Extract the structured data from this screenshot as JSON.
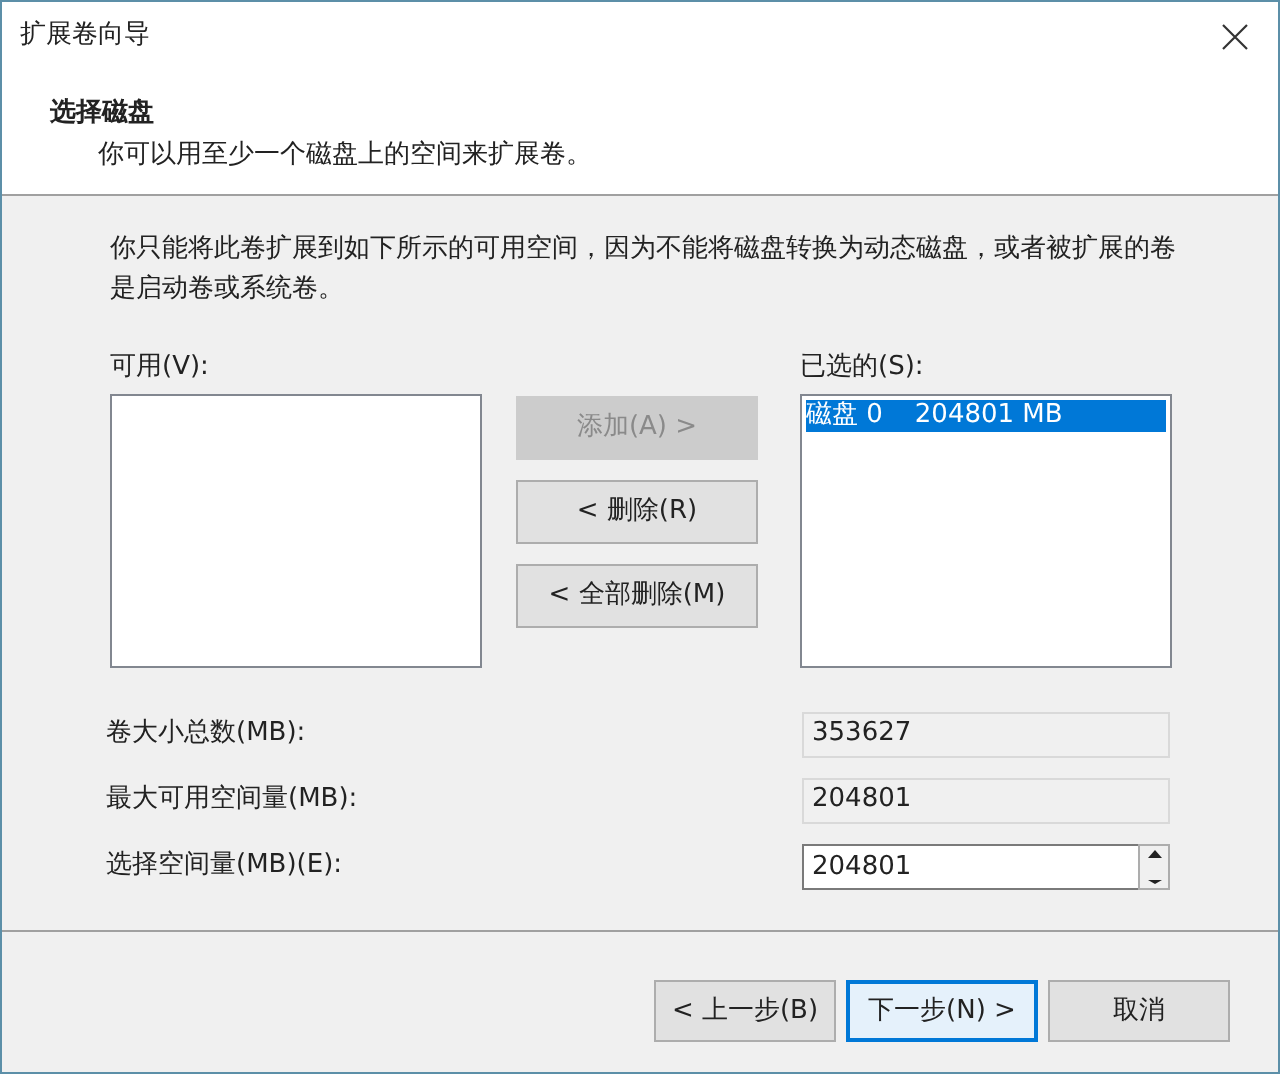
{
  "window": {
    "title": "扩展卷向导"
  },
  "header": {
    "title": "选择磁盘",
    "subtitle": "你可以用至少一个磁盘上的空间来扩展卷。"
  },
  "description": "你只能将此卷扩展到如下所示的可用空间，因为不能将磁盘转换为动态磁盘，或者被扩展的卷是启动卷或系统卷。",
  "available": {
    "label": "可用(V):"
  },
  "selected_list": {
    "label": "已选的(S):",
    "items": [
      {
        "name": "磁盘 0",
        "size": "204801 MB",
        "selected": true
      }
    ]
  },
  "move_buttons": [
    {
      "label": "添加(A) >",
      "disabled": true
    },
    {
      "label": "< 删除(R)",
      "disabled": false
    },
    {
      "label": "< 全部删除(M)",
      "disabled": false
    }
  ],
  "fields": [
    {
      "label": "卷大小总数(MB):",
      "value": "353627",
      "kind": "readonly"
    },
    {
      "label": "最大可用空间量(MB):",
      "value": "204801",
      "kind": "readonly"
    },
    {
      "label": "选择空间量(MB)(E):",
      "value": "204801",
      "kind": "spinner"
    }
  ],
  "footer_buttons": [
    {
      "label": "< 上一步(B)",
      "default": false
    },
    {
      "label": "下一步(N) >",
      "default": true
    },
    {
      "label": "取消",
      "default": false
    }
  ]
}
